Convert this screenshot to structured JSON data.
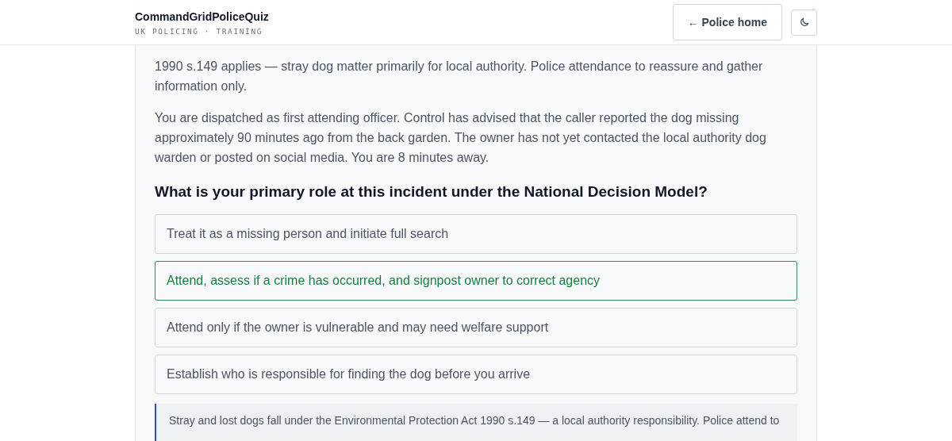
{
  "header": {
    "title": "CommandGridPoliceQuiz",
    "subtitle": "UK POLICING · TRAINING",
    "home_button": "← Police home"
  },
  "scenario": [
    "1990 s.149 applies — stray dog matter primarily for local authority. Police attendance to reassure and gather information only.",
    "You are dispatched as first attending officer. Control has advised that the caller reported the dog missing approximately 90 minutes ago from the back garden. The owner has not yet contacted the local authority dog warden or posted on social media. You are 8 minutes away."
  ],
  "question": "What is your primary role at this incident under the National Decision Model?",
  "options": [
    {
      "text": "Treat it as a missing person and initiate full search",
      "selected": false
    },
    {
      "text": "Attend, assess if a crime has occurred, and signpost owner to correct agency",
      "selected": true
    },
    {
      "text": "Attend only if the owner is vulnerable and may need welfare support",
      "selected": false
    },
    {
      "text": "Establish who is responsible for finding the dog before you arrive",
      "selected": false
    }
  ],
  "feedback": "Stray and lost dogs fall under the Environmental Protection Act 1990 s.149 — a local authority responsibility. Police attend to"
}
